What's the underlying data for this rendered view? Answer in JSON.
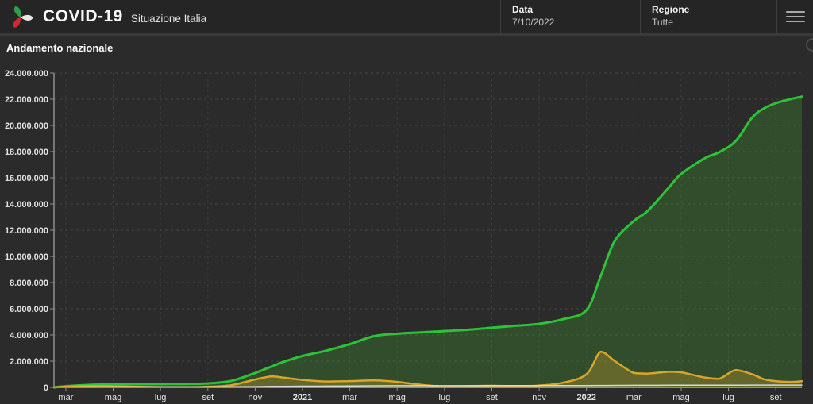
{
  "header": {
    "title": "COVID-19",
    "subtitle": "Situazione Italia",
    "logo_icon": "protezione-civile-tricolor-logo",
    "date_label": "Data",
    "date_value": "7/10/2022",
    "region_label": "Regione",
    "region_value": "Tutte",
    "menu_icon": "hamburger-menu"
  },
  "section": {
    "title": "Andamento nazionale"
  },
  "colors": {
    "background": "#2b2b2b",
    "header_background": "#252525",
    "divider": "#3a3a3a",
    "axis": "#8f8f8f",
    "grid_horizontal": "#45453f",
    "grid_vertical": "#3c3c3c",
    "tick_text": "#e3e3e3",
    "green_line": "#2bc437",
    "green_fill": "rgba(70,165,45,0.28)",
    "orange_line": "#d9a62a",
    "orange_fill": "rgba(216,166,42,0.30)",
    "white_line": "#d8d8d8"
  },
  "chart_data": {
    "type": "area",
    "title": "Andamento nazionale",
    "xlabel": "",
    "ylabel": "",
    "grid": true,
    "legend_position": "none",
    "ylim": [
      0,
      24000000
    ],
    "y_tick_step": 2000000,
    "y_tick_labels": [
      "0",
      "2.000.000",
      "4.000.000",
      "6.000.000",
      "8.000.000",
      "10.000.000",
      "12.000.000",
      "14.000.000",
      "16.000.000",
      "18.000.000",
      "20.000.000",
      "22.000.000",
      "24.000.000"
    ],
    "x_unit": "months_since_feb_2020",
    "xlim_months": [
      0.5,
      32.1
    ],
    "x_ticks": [
      {
        "month": 1,
        "label": "mar",
        "bold": false
      },
      {
        "month": 3,
        "label": "mag",
        "bold": false
      },
      {
        "month": 5,
        "label": "lug",
        "bold": false
      },
      {
        "month": 7,
        "label": "set",
        "bold": false
      },
      {
        "month": 9,
        "label": "nov",
        "bold": false
      },
      {
        "month": 11,
        "label": "2021",
        "bold": true
      },
      {
        "month": 13,
        "label": "mar",
        "bold": false
      },
      {
        "month": 15,
        "label": "mag",
        "bold": false
      },
      {
        "month": 17,
        "label": "lug",
        "bold": false
      },
      {
        "month": 19,
        "label": "set",
        "bold": false
      },
      {
        "month": 21,
        "label": "nov",
        "bold": false
      },
      {
        "month": 23,
        "label": "2022",
        "bold": true
      },
      {
        "month": 25,
        "label": "mar",
        "bold": false
      },
      {
        "month": 27,
        "label": "mag",
        "bold": false
      },
      {
        "month": 29,
        "label": "lug",
        "bold": false
      },
      {
        "month": 31,
        "label": "set",
        "bold": false
      }
    ],
    "x_months": [
      0.5,
      1,
      2,
      3,
      4,
      5,
      6,
      7,
      8,
      9,
      9.7,
      10.2,
      11,
      12,
      13,
      14,
      15,
      16,
      17,
      18,
      19,
      20,
      21,
      22,
      23,
      23.6,
      24.2,
      25,
      25.6,
      26.5,
      27,
      28,
      28.6,
      29.3,
      30,
      30.5,
      31,
      31.6,
      32.1
    ],
    "series": [
      {
        "name": "green-cumulative-total",
        "color": "#2bc437",
        "fill": "rgba(70,165,45,0.28)",
        "line_width": 3,
        "values_millions": [
          0.0,
          0.09,
          0.19,
          0.23,
          0.24,
          0.25,
          0.26,
          0.3,
          0.5,
          1.1,
          1.6,
          1.95,
          2.4,
          2.8,
          3.3,
          3.9,
          4.1,
          4.2,
          4.3,
          4.4,
          4.55,
          4.7,
          4.85,
          5.2,
          5.9,
          8.5,
          11.2,
          12.7,
          13.5,
          15.3,
          16.3,
          17.5,
          17.95,
          18.8,
          20.6,
          21.3,
          21.7,
          22.0,
          22.2
        ]
      },
      {
        "name": "orange-currently-positive",
        "color": "#d9a62a",
        "fill": "rgba(216,166,42,0.30)",
        "line_width": 2.5,
        "values_millions": [
          0.0,
          0.05,
          0.105,
          0.08,
          0.04,
          0.015,
          0.015,
          0.045,
          0.17,
          0.6,
          0.84,
          0.74,
          0.57,
          0.45,
          0.48,
          0.53,
          0.42,
          0.2,
          0.065,
          0.1,
          0.12,
          0.09,
          0.14,
          0.35,
          1.0,
          2.72,
          2.0,
          1.1,
          1.05,
          1.2,
          1.15,
          0.75,
          0.65,
          1.32,
          1.0,
          0.62,
          0.47,
          0.42,
          0.47
        ]
      },
      {
        "name": "white-flat-low",
        "color": "#d8d8d8",
        "fill": "none",
        "line_width": 1.5,
        "values_millions": [
          0.003,
          0.013,
          0.029,
          0.033,
          0.034,
          0.035,
          0.035,
          0.036,
          0.039,
          0.055,
          0.07,
          0.077,
          0.088,
          0.097,
          0.108,
          0.12,
          0.126,
          0.127,
          0.128,
          0.129,
          0.131,
          0.132,
          0.133,
          0.136,
          0.141,
          0.146,
          0.15,
          0.156,
          0.159,
          0.163,
          0.165,
          0.168,
          0.169,
          0.171,
          0.173,
          0.175,
          0.176,
          0.177,
          0.178
        ]
      }
    ]
  }
}
